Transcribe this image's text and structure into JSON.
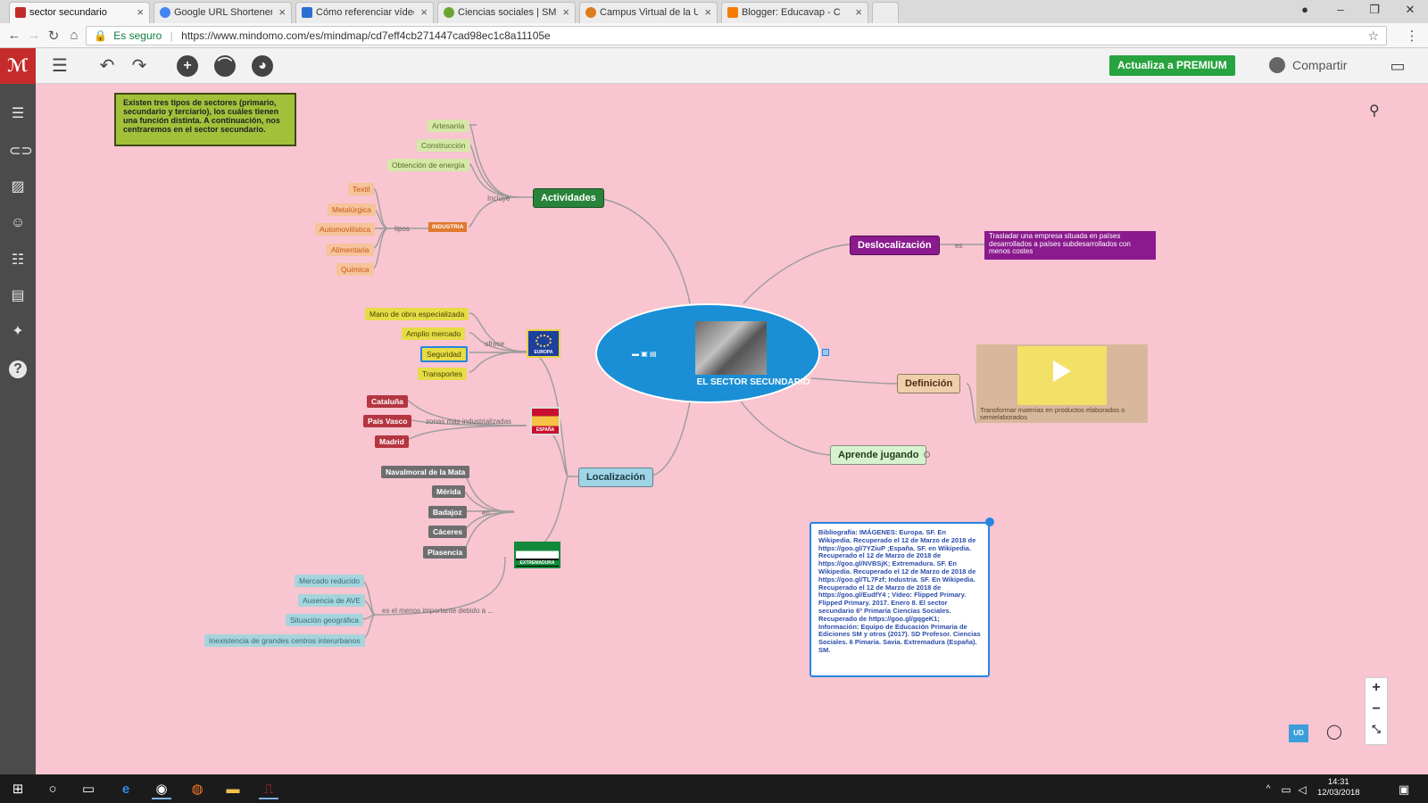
{
  "browser": {
    "tabs": [
      {
        "title": "sector secundario",
        "active": true,
        "color": "#c62b2b"
      },
      {
        "title": "Google URL Shortener",
        "active": false,
        "color": "#4285f4"
      },
      {
        "title": "Cómo referenciar vídeos",
        "active": false,
        "color": "#2a6fd1"
      },
      {
        "title": "Ciencias sociales | SMSA",
        "active": false,
        "color": "#6aa531"
      },
      {
        "title": "Campus Virtual de la UE",
        "active": false,
        "color": "#dd7b1d"
      },
      {
        "title": "Blogger: Educavap - Crea",
        "active": false,
        "color": "#f57c00"
      }
    ],
    "secure_label": "Es seguro",
    "url": "https://www.mindomo.com/es/mindmap/cd7eff4cb271447cad98ec1c8a11105e"
  },
  "toolbar": {
    "premium_label": "Actualiza a PREMIUM",
    "share_label": "Compartir"
  },
  "note": "Existen tres tipos de sectores (primario, secundario y terciario), los cuáles tienen una función distinta. A continuación, nos centraremos en el sector secundario.",
  "central": {
    "title": "EL SECTOR SECUNDARIO"
  },
  "actividades": {
    "label": "Actividades",
    "link_label": "Incluye",
    "items": [
      "Artesanía",
      "Construcción",
      "Obtención de energía"
    ],
    "industria": {
      "label": "INDUSTRIA",
      "link_label": "tipos",
      "items": [
        "Textil",
        "Metalúrgica",
        "Automovilística",
        "Alimentaria",
        "Química"
      ]
    }
  },
  "localizacion": {
    "label": "Localización",
    "europa": {
      "flag_label": "EUROPA",
      "link_label": "ofrece",
      "items": [
        "Mano de obra especializada",
        "Amplio mercado",
        "Seguridad",
        "Transportes"
      ]
    },
    "espana": {
      "flag_label": "ESPAÑA",
      "link_label": "zonas más industrializadas",
      "items": [
        "Cataluña",
        "País Vasco",
        "Madrid"
      ]
    },
    "extremadura": {
      "flag_label": "EXTREMADURA",
      "link_label": "en",
      "items": [
        "Navalmoral de la Mata",
        "Mérida",
        "Badajoz",
        "Cáceres",
        "Plasencia"
      ],
      "link_label_2": "es el menos importante debido a ...",
      "reasons": [
        "Mercado reducido",
        "Ausencia de AVE",
        "Situación geográfica",
        "Inexistencia de grandes centros interurbanos"
      ]
    }
  },
  "deslocalizacion": {
    "label": "Deslocalización",
    "link_label": "es",
    "text": "Trasladar una empresa situada en países desarrollados a países subdesarrollados con menos costes"
  },
  "definicion": {
    "label": "Definición",
    "caption": "Transformar materias en productos elaborados o semielaborados"
  },
  "aprende": {
    "label": "Aprende jugando"
  },
  "bibliografia": "Bibliografía: IMÁGENES: Europa. SF. En Wikipedia. Recuperado el 12 de Marzo de 2018 de https://goo.gl/7YZiuP ;España. SF. en Wikipedia. Recuperado el 12 de Marzo de 2018 de https://goo.gl/NVBSjK; Extremadura. SF. En Wikipedia. Recuperado el 12 de Marzo de 2018 de https://goo.gl/TL7Fzf; Industria. SF. En Wikipedia. Recuperado el 12 de Marzo de 2018 de https://goo.gl/EudfY4 ; Vídeo: Flipped Primary. Flipped Primary. 2017. Enero 8. El sector secundario 6º Primaria Ciencias Sociales. Recuperado de https://goo.gl/gqgeK1; Información: Equipo de Educación Primaria de Ediciones SM y otros (2017). SD Profesor. Ciencias Sociales. 6 Pimaria. Savia. Extremadura (España). SM.",
  "ud_label": "UD",
  "clock": {
    "time": "14:31",
    "date": "12/03/2018"
  }
}
